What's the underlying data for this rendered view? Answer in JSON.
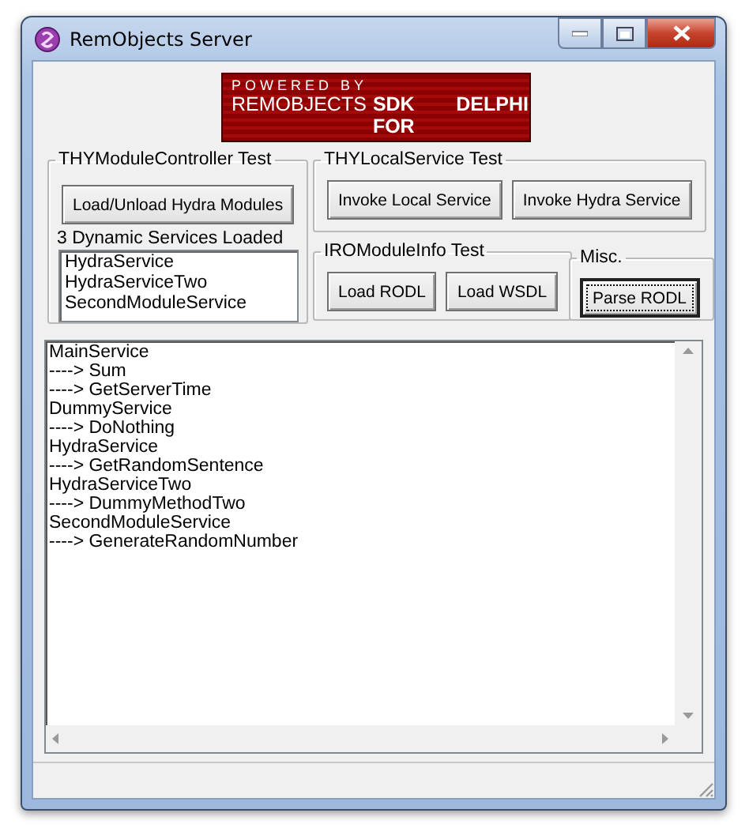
{
  "window": {
    "title": "RemObjects Server"
  },
  "banner": {
    "line_1": "POWERED BY",
    "line_2": "REMOBJECTS",
    "line_3": "SDK FOR",
    "line_4": "DELPHI"
  },
  "module_controller": {
    "title": "THYModuleController Test",
    "button": {
      "label": "Load/Unload Hydra Modules",
      "focused": false
    },
    "status": "3 Dynamic Services Loaded",
    "services": [
      "HydraService",
      "HydraServiceTwo",
      "SecondModuleService"
    ]
  },
  "local_service": {
    "title": "THYLocalService Test",
    "buttons": [
      {
        "label": "Invoke Local Service",
        "focused": false
      },
      {
        "label": "Invoke Hydra Service",
        "focused": false
      }
    ]
  },
  "module_info": {
    "title": "IROModuleInfo Test",
    "buttons": [
      {
        "label": "Load RODL",
        "focused": false
      },
      {
        "label": "Load WSDL",
        "focused": false
      }
    ]
  },
  "misc": {
    "title": "Misc.",
    "buttons": [
      {
        "label": "Parse RODL",
        "focused": true
      }
    ]
  },
  "log": [
    {
      "text": "MainService"
    },
    {
      "text": "----> Sum"
    },
    {
      "text": "----> GetServerTime"
    },
    {
      "text": "DummyService"
    },
    {
      "text": "----> DoNothing"
    },
    {
      "text": "HydraService"
    },
    {
      "text": "----> GetRandomSentence"
    },
    {
      "text": "HydraServiceTwo"
    },
    {
      "text": "----> DummyMethodTwo"
    },
    {
      "text": "SecondModuleService"
    },
    {
      "text": "----> GenerateRandomNumber"
    }
  ]
}
